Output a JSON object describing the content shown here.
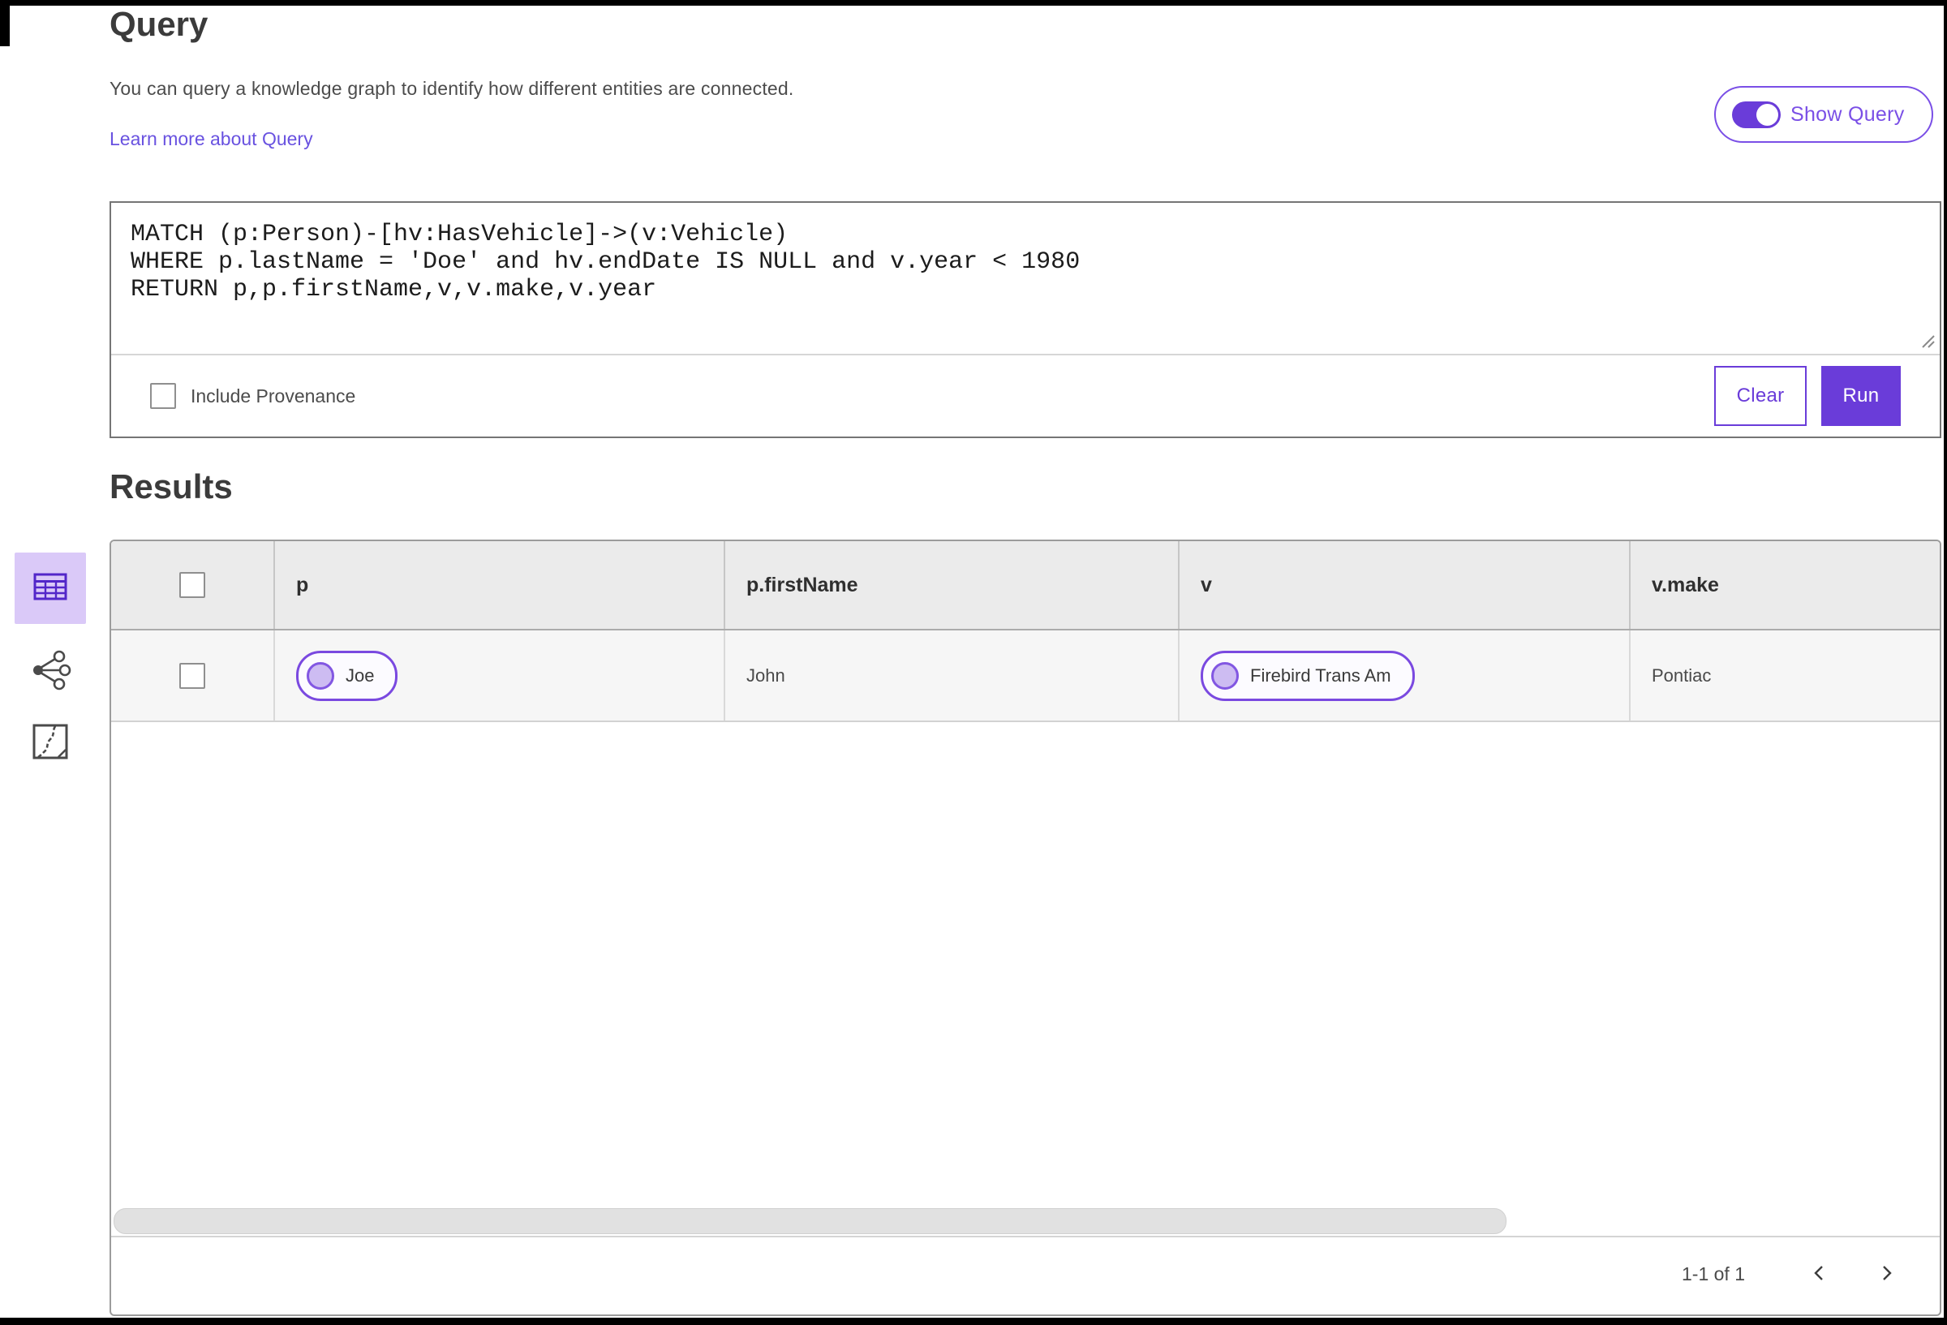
{
  "theme": {
    "primary": "#6a3cd9",
    "primary-border": "#7a4fe6",
    "link": "#6952e0",
    "selected-bg": "#dac9f8",
    "pill-border": "#7a49e0"
  },
  "query": {
    "title": "Query",
    "description": "You can query a knowledge graph to identify how different entities are connected.",
    "learn_more_label": "Learn more about Query",
    "show_query_label": "Show Query",
    "show_query_on": "on",
    "text": "MATCH (p:Person)-[hv:HasVehicle]->(v:Vehicle)\nWHERE p.lastName = 'Doe' and hv.endDate IS NULL and v.year < 1980\nRETURN p,p.firstName,v,v.make,v.year",
    "include_provenance_label": "Include Provenance",
    "include_provenance_checked": "unchecked",
    "clear_label": "Clear",
    "run_label": "Run"
  },
  "results": {
    "title": "Results",
    "view_tools": [
      {
        "name": "table-view",
        "selected": true
      },
      {
        "name": "link-chart-view",
        "selected": false
      },
      {
        "name": "map-view",
        "selected": false
      }
    ],
    "table": {
      "columns": [
        "p",
        "p.firstName",
        "v",
        "v.make"
      ],
      "rows": [
        {
          "p": "Joe",
          "p_firstName": "John",
          "v": "Firebird Trans Am",
          "v_make": "Pontiac",
          "selected": "unchecked"
        }
      ],
      "pagination": {
        "range_label": "1-1 of 1",
        "prev_icon": "chevron-left",
        "next_icon": "chevron-right"
      }
    }
  }
}
